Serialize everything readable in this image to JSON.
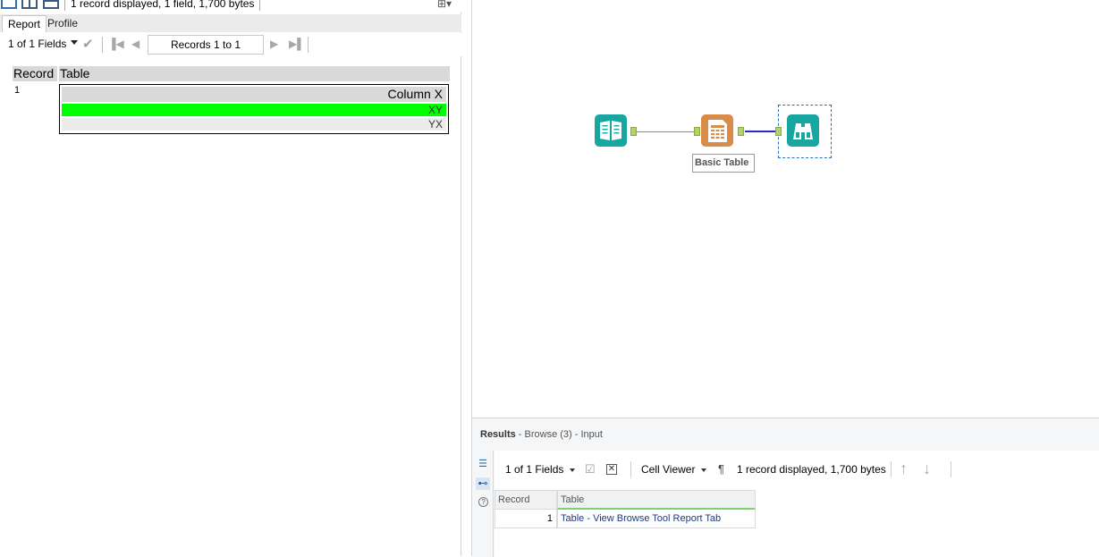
{
  "browse": {
    "status_top": "1 record displayed, 1 field, 1,700 bytes",
    "add_view": "⊞▾",
    "tabs": [
      {
        "label": "Report"
      },
      {
        "label": "Profile"
      }
    ],
    "fields_selector": "1 of 1 Fields",
    "records_range": "Records 1 to 1",
    "report": {
      "header_record": "Record",
      "header_table": "Table",
      "row_number": "1",
      "embedded_table": {
        "column_header": "Column X",
        "rows": [
          "XY",
          "YX"
        ],
        "highlight_color": "#00ff00"
      }
    }
  },
  "canvas": {
    "tool_label": "Basic Table"
  },
  "results": {
    "title_bold": "Results",
    "title_rest": " - Browse (3) - Input",
    "fields_selector": "1 of 1 Fields",
    "viewer": "Cell Viewer",
    "pilcrow": "¶",
    "status": "1 record displayed, 1,700 bytes",
    "grid": {
      "headers": [
        "Record",
        "Table"
      ],
      "rows": [
        {
          "record": "1",
          "table": "Table - View Browse Tool Report Tab"
        }
      ]
    }
  },
  "colors": {
    "tool_teal": "#17a6a0",
    "tool_orange": "#d98c4a",
    "connection_selected": "#2a2ad0"
  }
}
